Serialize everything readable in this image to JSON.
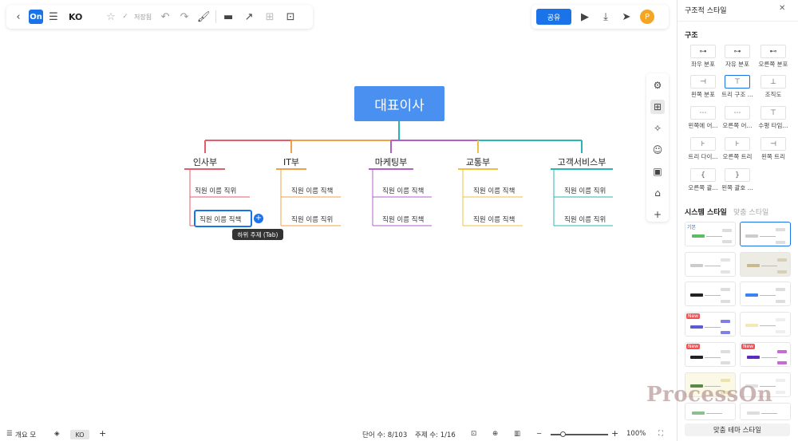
{
  "toolbar": {
    "logo": "On",
    "doc_title": "KO",
    "saved": "저장됨",
    "share": "공유",
    "avatar": "P"
  },
  "mindmap": {
    "root": "대표이사",
    "departments": [
      {
        "name": "인사부",
        "color": "#e35d6a",
        "subs": [
          "직원 이름 직위",
          "직원 이름 직책"
        ]
      },
      {
        "name": "IT부",
        "color": "#f0a04b",
        "subs": [
          "직원 이름 직책",
          "직원 이름 직위"
        ]
      },
      {
        "name": "마케팅부",
        "color": "#b45fc8",
        "subs": [
          "직원 이름 직책",
          "직원 이름 직책"
        ]
      },
      {
        "name": "교통부",
        "color": "#f0c040",
        "subs": [
          "직원 이름 직책",
          "직원 이름 직책"
        ]
      },
      {
        "name": "고객서비스부",
        "color": "#2bb5b0",
        "subs": [
          "직원 이름 직위",
          "직원 이름 직위"
        ]
      }
    ],
    "tooltip": "하위 주제 (Tab)"
  },
  "bottombar": {
    "outline": "개요 모",
    "page_chip": "KO",
    "words": "단어 수: 8/103",
    "topics": "주제 수: 1/16",
    "zoom": "100%"
  },
  "panel": {
    "title": "구조적 스타일",
    "structure_heading": "구조",
    "structures": [
      "좌우 분포",
      "자유 분포",
      "오른쪽 분포",
      "왼쪽 분포",
      "트리 구조 ...",
      "조직도",
      "왼쪽에 어...",
      "오른쪽 어...",
      "수평 타임...",
      "트리 다이...",
      "오른쪽 트리",
      "왼쪽 트리",
      "오른쪽 괄...",
      "왼쪽 괄호 ..."
    ],
    "system_style": "시스템 스타일",
    "custom_style": "맞춤 스타일",
    "basic_label": "기본",
    "new_badge": "New",
    "match_theme": "맞춤 테마 스타일"
  },
  "watermark": "ProcessOn"
}
